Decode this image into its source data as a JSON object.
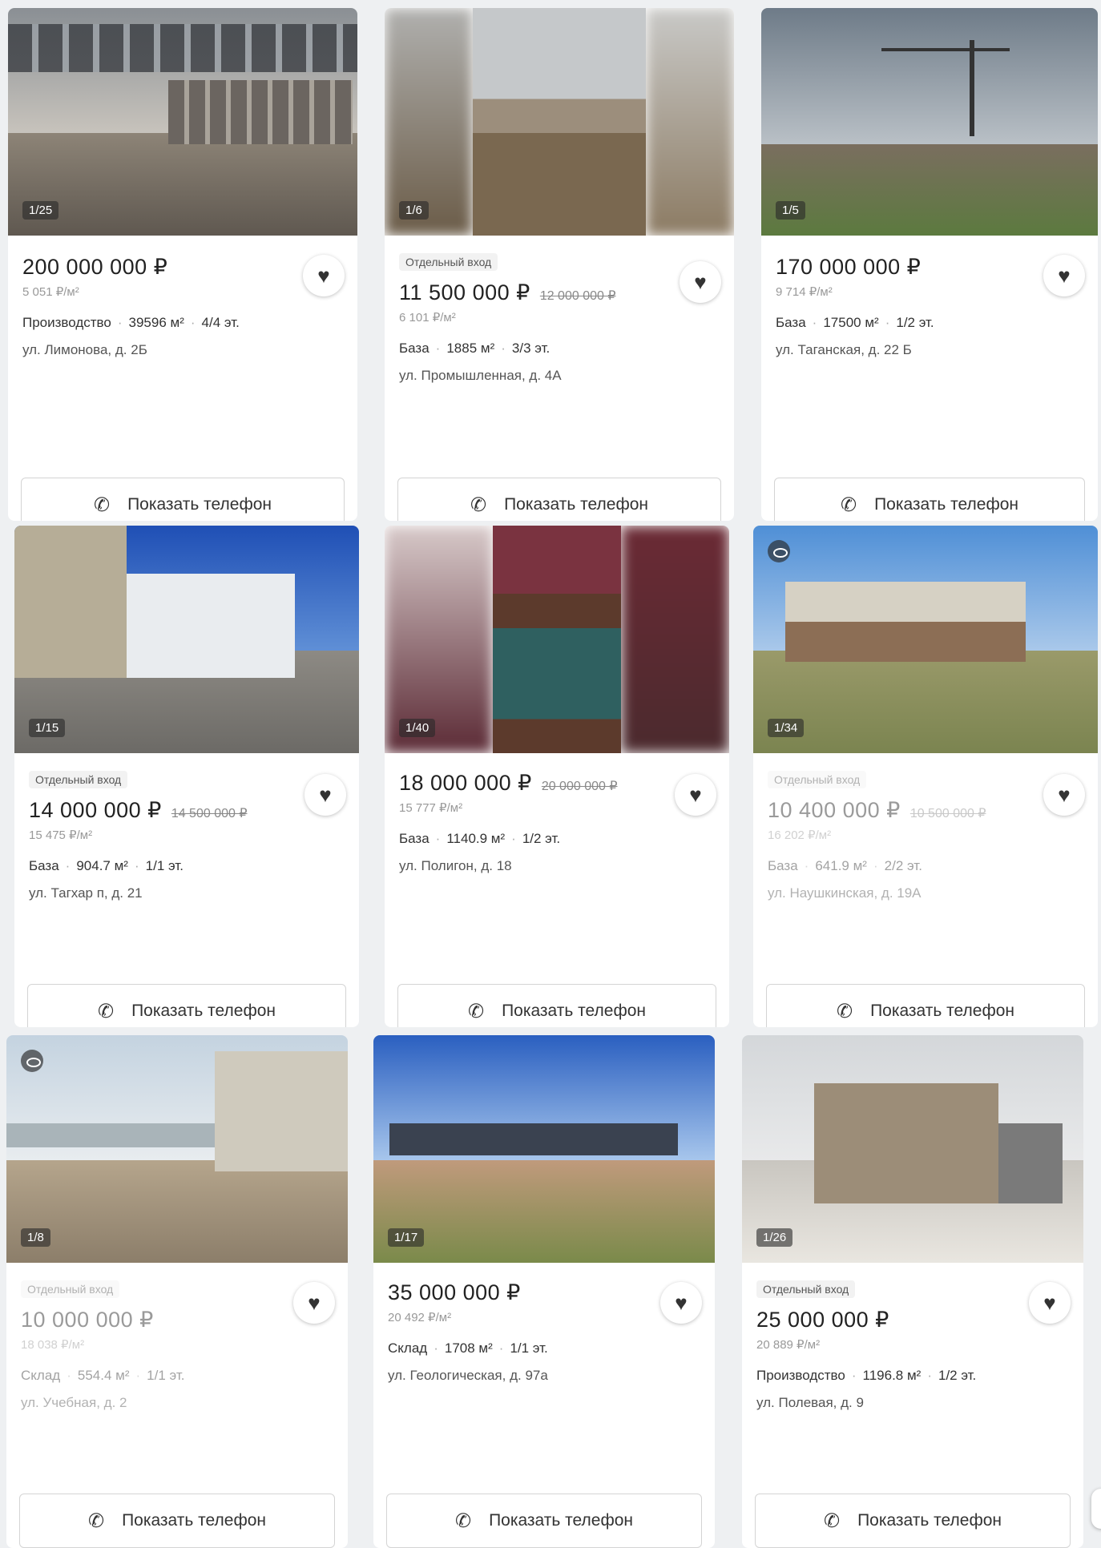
{
  "cards": [
    {
      "counter": "1/25",
      "badge": "",
      "price": "200 000 000 ₽",
      "old": "",
      "ppm": "5 051 ₽/м²",
      "type": "Производство",
      "area": "39596 м²",
      "floor": "4/4 эт.",
      "addr": "ул. Лимонова, д. 2Б",
      "phone": "Показать телефон"
    },
    {
      "counter": "1/6",
      "badge": "Отдельный вход",
      "price": "11 500 000 ₽",
      "old": "12 000 000 ₽",
      "ppm": "6 101 ₽/м²",
      "type": "База",
      "area": "1885 м²",
      "floor": "3/3 эт.",
      "addr": "ул. Промышленная, д. 4А",
      "phone": "Показать телефон"
    },
    {
      "counter": "1/5",
      "badge": "",
      "price": "170 000 000 ₽",
      "old": "",
      "ppm": "9 714 ₽/м²",
      "type": "База",
      "area": "17500 м²",
      "floor": "1/2 эт.",
      "addr": "ул. Таганская, д. 22 Б",
      "phone": "Показать телефон"
    },
    {
      "counter": "1/15",
      "badge": "Отдельный вход",
      "price": "14 000 000 ₽",
      "old": "14 500 000 ₽",
      "ppm": "15 475 ₽/м²",
      "type": "База",
      "area": "904.7 м²",
      "floor": "1/1 эт.",
      "addr": "ул. Тагхар п, д. 21",
      "phone": "Показать телефон"
    },
    {
      "counter": "1/40",
      "badge": "",
      "price": "18 000 000 ₽",
      "old": "20 000 000 ₽",
      "ppm": "15 777 ₽/м²",
      "type": "База",
      "area": "1140.9 м²",
      "floor": "1/2 эт.",
      "addr": "ул. Полигон, д. 18",
      "phone": "Показать телефон"
    },
    {
      "counter": "1/34",
      "badge": "Отдельный вход",
      "price": "10 400 000 ₽",
      "old": "10 500 000 ₽",
      "ppm": "16 202 ₽/м²",
      "type": "База",
      "area": "641.9 м²",
      "floor": "2/2 эт.",
      "addr": "ул. Наушкинская, д. 19А",
      "phone": "Показать телефон"
    },
    {
      "counter": "1/8",
      "badge": "Отдельный вход",
      "price": "10 000 000 ₽",
      "old": "",
      "ppm": "18 038 ₽/м²",
      "type": "Склад",
      "area": "554.4 м²",
      "floor": "1/1 эт.",
      "addr": "ул. Учебная, д. 2",
      "phone": "Показать телефон"
    },
    {
      "counter": "1/17",
      "badge": "",
      "price": "35 000 000 ₽",
      "old": "",
      "ppm": "20 492 ₽/м²",
      "type": "Склад",
      "area": "1708 м²",
      "floor": "1/1 эт.",
      "addr": "ул. Геологическая, д. 97а",
      "phone": "Показать телефон"
    },
    {
      "counter": "1/26",
      "badge": "Отдельный вход",
      "price": "25 000 000 ₽",
      "old": "",
      "ppm": "20 889 ₽/м²",
      "type": "Производство",
      "area": "1196.8 м²",
      "floor": "1/2 эт.",
      "addr": "ул. Полевая, д. 9",
      "phone": "Показать телефон"
    }
  ],
  "colors": {
    "accent": "#333333",
    "muted": "#999999"
  },
  "icons": {
    "favorite": "heart-icon",
    "phone": "phone-icon",
    "views": "eye-icon"
  }
}
